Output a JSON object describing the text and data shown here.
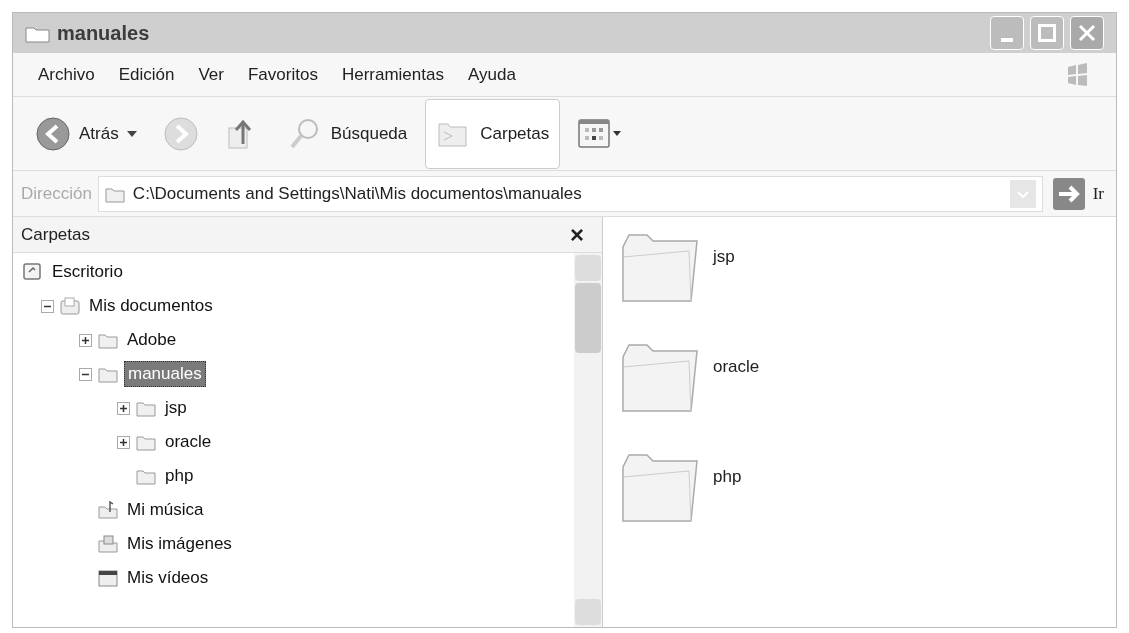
{
  "window": {
    "title": "manuales"
  },
  "menu": [
    "Archivo",
    "Edición",
    "Ver",
    "Favoritos",
    "Herramientas",
    "Ayuda"
  ],
  "toolbar": [
    {
      "kind": "back",
      "label": "Atrás"
    },
    {
      "kind": "forward"
    },
    {
      "kind": "up"
    },
    {
      "kind": "search",
      "label": "Búsqueda"
    },
    {
      "kind": "folders",
      "label": "Carpetas",
      "selected": true
    },
    {
      "kind": "views"
    }
  ],
  "address": {
    "label": "Dirección",
    "value": "C:\\Documents and Settings\\Nati\\Mis documentos\\manuales",
    "go": "Ir"
  },
  "folders_pane": {
    "title": "Carpetas",
    "close": "×",
    "tree": [
      {
        "label": "Escritorio",
        "kind": "desktop",
        "selected": false,
        "children": [
          {
            "label": "Mis documentos",
            "kind": "documents",
            "expanded": true,
            "selected": false,
            "children": [
              {
                "label": "Adobe",
                "kind": "folder",
                "expanded": false,
                "selected": false
              },
              {
                "label": "manuales",
                "kind": "folder",
                "expanded": true,
                "selected": true,
                "children": [
                  {
                    "label": "jsp",
                    "kind": "folder",
                    "expanded": false,
                    "selected": false
                  },
                  {
                    "label": "oracle",
                    "kind": "folder",
                    "expanded": false,
                    "selected": false
                  },
                  {
                    "label": "php",
                    "kind": "folder",
                    "selected": false
                  }
                ]
              },
              {
                "label": "Mi música",
                "kind": "music",
                "selected": false
              },
              {
                "label": "Mis imágenes",
                "kind": "pictures",
                "selected": false
              },
              {
                "label": "Mis vídeos",
                "kind": "videos",
                "selected": false
              }
            ]
          }
        ]
      }
    ]
  },
  "files": [
    {
      "name": "jsp"
    },
    {
      "name": "oracle"
    },
    {
      "name": "php"
    }
  ]
}
